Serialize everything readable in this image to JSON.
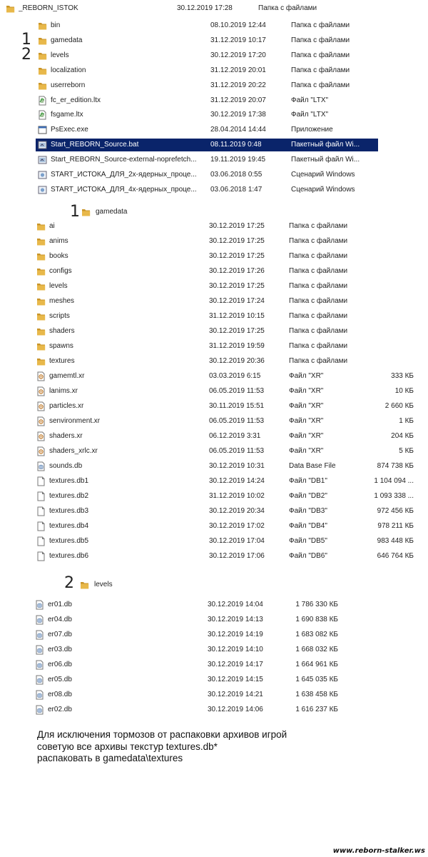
{
  "top_header": {
    "name": "_REBORN_ISTOK",
    "date": "30.12.2019 17:28",
    "type": "Папка с файлами"
  },
  "markers": {
    "one": "1",
    "two": "2"
  },
  "root_list": [
    {
      "name": "bin",
      "date": "08.10.2019 12:44",
      "type": "Папка с файлами",
      "icon": "folder-icon"
    },
    {
      "name": "gamedata",
      "date": "31.12.2019 10:17",
      "type": "Папка с файлами",
      "icon": "folder-icon"
    },
    {
      "name": "levels",
      "date": "30.12.2019 17:20",
      "type": "Папка с файлами",
      "icon": "folder-icon"
    },
    {
      "name": "localization",
      "date": "31.12.2019 20:01",
      "type": "Папка с файлами",
      "icon": "folder-icon"
    },
    {
      "name": "userreborn",
      "date": "31.12.2019 20:22",
      "type": "Папка с файлами",
      "icon": "folder-icon"
    },
    {
      "name": "fc_er_edition.ltx",
      "date": "31.12.2019 20:07",
      "type": "Файл \"LTX\"",
      "icon": "ltx-file-icon"
    },
    {
      "name": "fsgame.ltx",
      "date": "30.12.2019 17:38",
      "type": "Файл \"LTX\"",
      "icon": "ltx-file-icon"
    },
    {
      "name": "PsExec.exe",
      "date": "28.04.2014 14:44",
      "type": "Приложение",
      "icon": "exe-file-icon"
    },
    {
      "name": "Start_REBORN_Source.bat",
      "date": "08.11.2019 0:48",
      "type": "Пакетный файл Wi...",
      "icon": "bat-file-icon",
      "selected": true
    },
    {
      "name": "Start_REBORN_Source-external-noprefetch...",
      "date": "19.11.2019 19:45",
      "type": "Пакетный файл Wi...",
      "icon": "bat-file-icon"
    },
    {
      "name": "START_ИСТОКА_ДЛЯ_2х-ядерных_проце...",
      "date": "03.06.2018 0:55",
      "type": "Сценарий Windows",
      "icon": "script-file-icon"
    },
    {
      "name": "START_ИСТОКА_ДЛЯ_4х-ядерных_проце...",
      "date": "03.06.2018 1:47",
      "type": "Сценарий Windows",
      "icon": "script-file-icon"
    }
  ],
  "gamedata_header": {
    "number": "1",
    "name": "gamedata"
  },
  "gamedata_list": [
    {
      "name": "ai",
      "date": "30.12.2019 17:25",
      "type": "Папка с файлами",
      "size": "",
      "icon": "folder-icon"
    },
    {
      "name": "anims",
      "date": "30.12.2019 17:25",
      "type": "Папка с файлами",
      "size": "",
      "icon": "folder-icon"
    },
    {
      "name": "books",
      "date": "30.12.2019 17:25",
      "type": "Папка с файлами",
      "size": "",
      "icon": "folder-icon"
    },
    {
      "name": "configs",
      "date": "30.12.2019 17:26",
      "type": "Папка с файлами",
      "size": "",
      "icon": "folder-icon"
    },
    {
      "name": "levels",
      "date": "30.12.2019 17:25",
      "type": "Папка с файлами",
      "size": "",
      "icon": "folder-icon"
    },
    {
      "name": "meshes",
      "date": "30.12.2019 17:24",
      "type": "Папка с файлами",
      "size": "",
      "icon": "folder-icon"
    },
    {
      "name": "scripts",
      "date": "31.12.2019 10:15",
      "type": "Папка с файлами",
      "size": "",
      "icon": "folder-icon"
    },
    {
      "name": "shaders",
      "date": "30.12.2019 17:25",
      "type": "Папка с файлами",
      "size": "",
      "icon": "folder-icon"
    },
    {
      "name": "spawns",
      "date": "31.12.2019 19:59",
      "type": "Папка с файлами",
      "size": "",
      "icon": "folder-icon"
    },
    {
      "name": "textures",
      "date": "30.12.2019 20:36",
      "type": "Папка с файлами",
      "size": "",
      "icon": "folder-icon"
    },
    {
      "name": "gamemtl.xr",
      "date": "03.03.2019 6:15",
      "type": "Файл \"XR\"",
      "size": "333 КБ",
      "icon": "xr-file-icon"
    },
    {
      "name": "lanims.xr",
      "date": "06.05.2019 11:53",
      "type": "Файл \"XR\"",
      "size": "10 КБ",
      "icon": "xr-file-icon"
    },
    {
      "name": "particles.xr",
      "date": "30.11.2019 15:51",
      "type": "Файл \"XR\"",
      "size": "2 660 КБ",
      "icon": "xr-file-icon"
    },
    {
      "name": "senvironment.xr",
      "date": "06.05.2019 11:53",
      "type": "Файл \"XR\"",
      "size": "1 КБ",
      "icon": "xr-file-icon"
    },
    {
      "name": "shaders.xr",
      "date": "06.12.2019 3:31",
      "type": "Файл \"XR\"",
      "size": "204 КБ",
      "icon": "xr-file-icon"
    },
    {
      "name": "shaders_xrlc.xr",
      "date": "06.05.2019 11:53",
      "type": "Файл \"XR\"",
      "size": "5 КБ",
      "icon": "xr-file-icon"
    },
    {
      "name": "sounds.db",
      "date": "30.12.2019 10:31",
      "type": "Data Base File",
      "size": "874 738 КБ",
      "icon": "db-file-icon"
    },
    {
      "name": "textures.db1",
      "date": "30.12.2019 14:24",
      "type": "Файл \"DB1\"",
      "size": "1 104 094 ...",
      "icon": "blank-file-icon"
    },
    {
      "name": "textures.db2",
      "date": "31.12.2019 10:02",
      "type": "Файл \"DB2\"",
      "size": "1 093 338 ...",
      "icon": "blank-file-icon"
    },
    {
      "name": "textures.db3",
      "date": "30.12.2019 20:34",
      "type": "Файл \"DB3\"",
      "size": "972 456 КБ",
      "icon": "blank-file-icon"
    },
    {
      "name": "textures.db4",
      "date": "30.12.2019 17:02",
      "type": "Файл \"DB4\"",
      "size": "978 211 КБ",
      "icon": "blank-file-icon"
    },
    {
      "name": "textures.db5",
      "date": "30.12.2019 17:04",
      "type": "Файл \"DB5\"",
      "size": "983 448 КБ",
      "icon": "blank-file-icon"
    },
    {
      "name": "textures.db6",
      "date": "30.12.2019 17:06",
      "type": "Файл \"DB6\"",
      "size": "646 764 КБ",
      "icon": "blank-file-icon"
    }
  ],
  "levels_header": {
    "number": "2",
    "name": "levels"
  },
  "levels_list": [
    {
      "name": "er01.db",
      "date": "30.12.2019 14:04",
      "size": "1 786 330 КБ",
      "icon": "db-file-icon"
    },
    {
      "name": "er04.db",
      "date": "30.12.2019 14:13",
      "size": "1 690 838 КБ",
      "icon": "db-file-icon"
    },
    {
      "name": "er07.db",
      "date": "30.12.2019 14:19",
      "size": "1 683 082 КБ",
      "icon": "db-file-icon"
    },
    {
      "name": "er03.db",
      "date": "30.12.2019 14:10",
      "size": "1 668 032 КБ",
      "icon": "db-file-icon"
    },
    {
      "name": "er06.db",
      "date": "30.12.2019 14:17",
      "size": "1 664 961 КБ",
      "icon": "db-file-icon"
    },
    {
      "name": "er05.db",
      "date": "30.12.2019 14:15",
      "size": "1 645 035 КБ",
      "icon": "db-file-icon"
    },
    {
      "name": "er08.db",
      "date": "30.12.2019 14:21",
      "size": "1 638 458 КБ",
      "icon": "db-file-icon"
    },
    {
      "name": "er02.db",
      "date": "30.12.2019 14:06",
      "size": "1 616 237 КБ",
      "icon": "db-file-icon"
    }
  ],
  "note": {
    "line1": "Для исключения тормозов от распаковки архивов игрой",
    "line2": "советую все архивы текстур textures.db*",
    "line3": "распаковать в gamedata\\textures"
  },
  "watermark": "www.reborn-stalker.ws",
  "colors": {
    "selection": "#0a246a",
    "folder": "#e8b84a",
    "folder_dark": "#c9952a"
  }
}
